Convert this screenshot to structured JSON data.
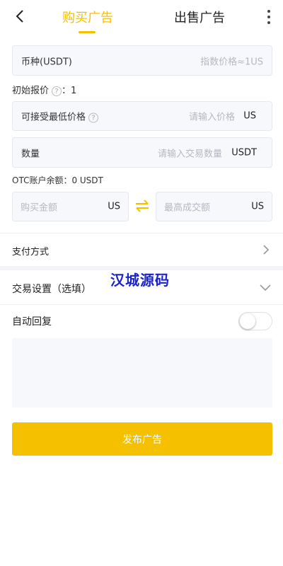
{
  "header": {
    "back_icon": "chevron-left-icon",
    "tab_buy": "购买广告",
    "tab_sell": "出售广告",
    "more_icon": "vertical-dots-icon",
    "active_color": "#f5c000"
  },
  "currency": {
    "label": "币种(USDT)",
    "placeholder": "指数价格≈1US"
  },
  "initial_price": {
    "label": "初始报价",
    "colon_value": "：1"
  },
  "min_price": {
    "label": "可接受最低价格",
    "placeholder": "请输入价格",
    "unit": "US"
  },
  "quantity": {
    "label": "数量",
    "placeholder": "请输入交易数量",
    "unit": "USDT"
  },
  "balance": {
    "text": "OTC账户余额：0 USDT"
  },
  "amounts": {
    "buy_placeholder": "购买金额",
    "buy_unit": "US",
    "max_placeholder": "最高成交额",
    "max_unit": "US",
    "swap_icon": "swap-arrows-icon"
  },
  "payment": {
    "label": "支付方式",
    "chevron_icon": "chevron-right-icon"
  },
  "trade_settings": {
    "label": "交易设置（选填）",
    "chevron_icon": "chevron-down-icon"
  },
  "auto_reply": {
    "label": "自动回复",
    "enabled": false
  },
  "watermark": "汉城源码",
  "submit": {
    "label": "发布广告"
  }
}
